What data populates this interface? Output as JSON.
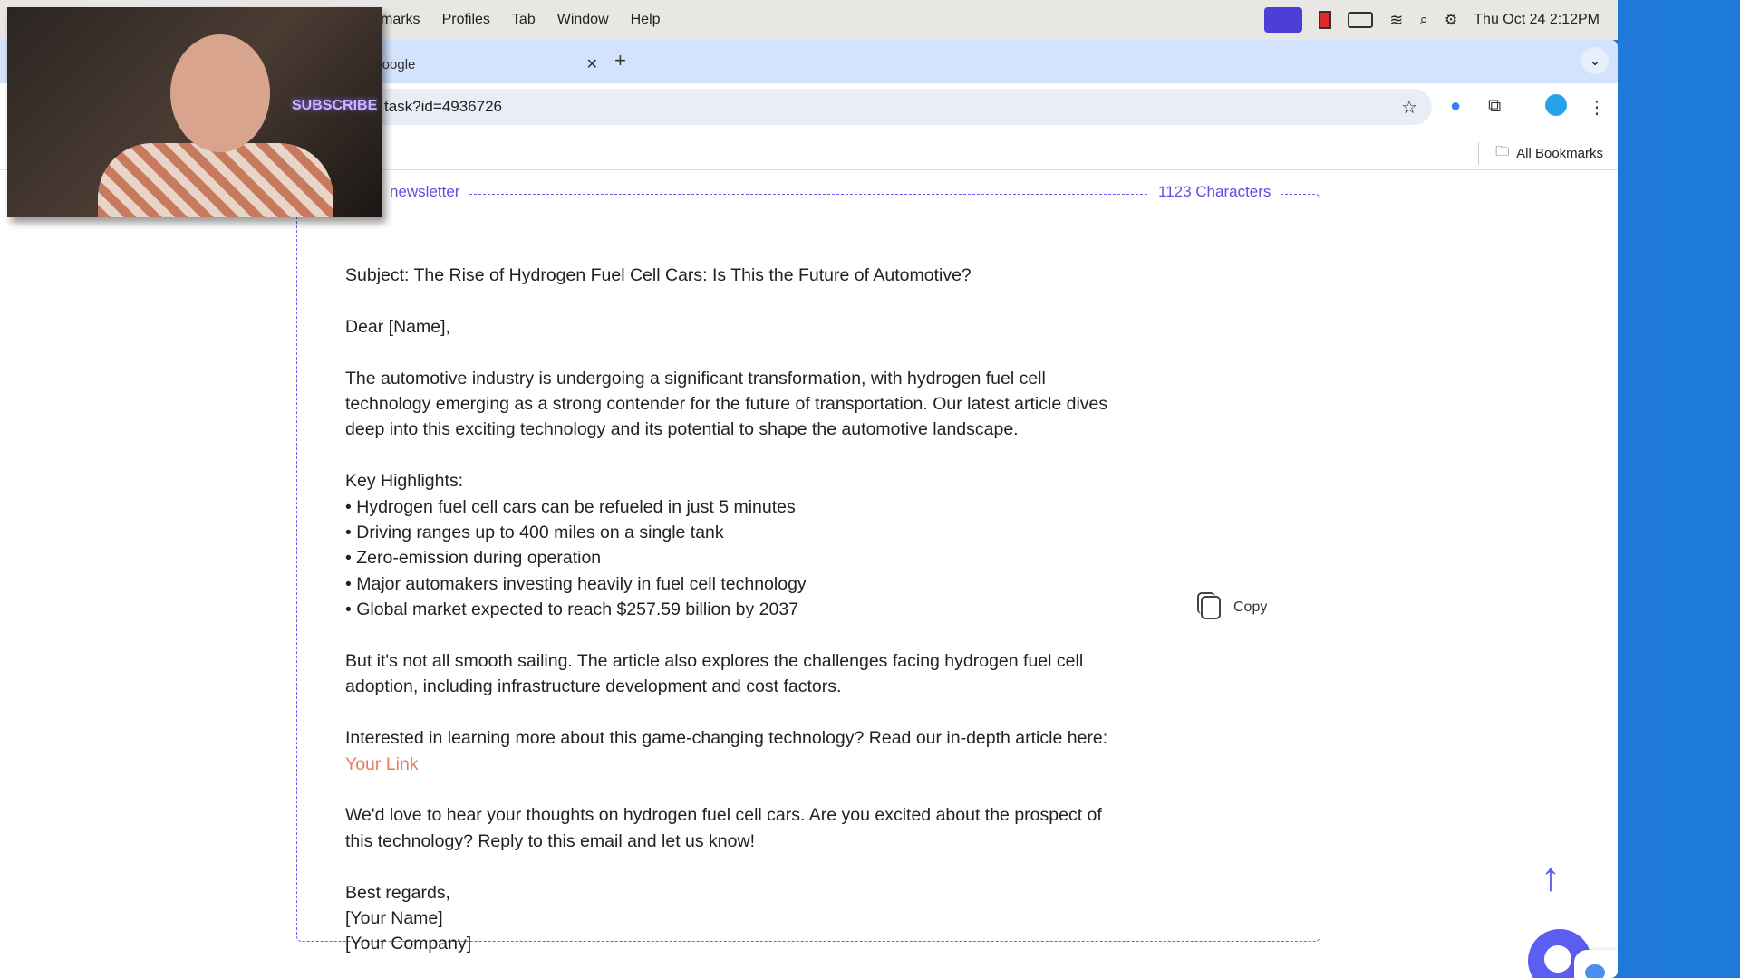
{
  "menubar": {
    "menus": [
      "marks",
      "Profiles",
      "Tab",
      "Window",
      "Help"
    ],
    "clock": "Thu Oct 24  2:12PM"
  },
  "browser": {
    "tab_title": "Google",
    "url": "task?id=4936726",
    "all_bookmarks": "All Bookmarks"
  },
  "card": {
    "label": "newsletter",
    "char_count": "1123 Characters",
    "copy_label": "Copy",
    "subject": "Subject: The Rise of Hydrogen Fuel Cell Cars: Is This the Future of Automotive?",
    "greeting": "Dear [Name],",
    "intro": "The automotive industry is undergoing a significant transformation, with hydrogen fuel cell technology emerging as a strong contender for the future of transportation. Our latest article dives deep into this exciting technology and its potential to shape the automotive landscape.",
    "highlights_title": "Key Highlights:",
    "highlights": [
      "• Hydrogen fuel cell cars can be refueled in just 5 minutes",
      "• Driving ranges up to 400 miles on a single tank",
      "• Zero-emission during operation",
      "• Major automakers investing heavily in fuel cell technology",
      "• Global market expected to reach $257.59 billion by 2037"
    ],
    "challenges": "But it's not all smooth sailing. The article also explores the challenges facing hydrogen fuel cell adoption, including infrastructure development and cost factors.",
    "cta": "Interested in learning more about this game-changing technology? Read our in-depth article here: ",
    "link": "Your Link",
    "feedback": "We'd love to hear your thoughts on hydrogen fuel cell cars. Are you excited about the prospect of this technology? Reply to this email and let us know!",
    "signoff": [
      "Best regards,",
      "[Your Name]",
      "[Your Company]"
    ]
  },
  "webcam": {
    "sign": "SUBSCRIBE"
  },
  "colors": {
    "accent": "#5b4fe6",
    "link": "#ec7a5c",
    "tabbar": "#d3e3fd"
  }
}
